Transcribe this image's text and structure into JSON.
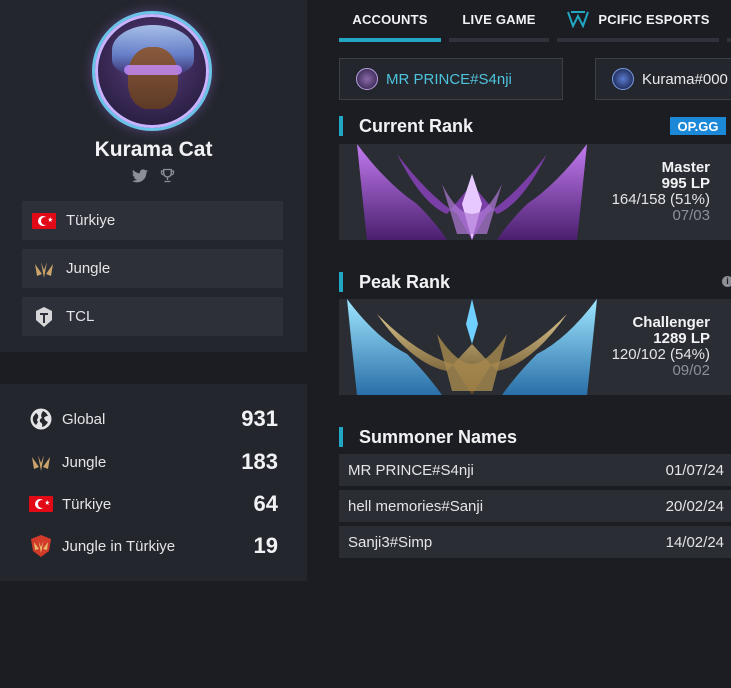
{
  "profile": {
    "name": "Kurama Cat",
    "social": [
      "twitter-icon",
      "trophy-icon"
    ],
    "info": [
      {
        "icon": "turkey-flag-icon",
        "label": "Türkiye"
      },
      {
        "icon": "jungle-role-icon",
        "label": "Jungle"
      },
      {
        "icon": "tcl-league-icon",
        "label": "TCL"
      }
    ]
  },
  "stats": [
    {
      "icon": "globe-icon",
      "label": "Global",
      "value": "931"
    },
    {
      "icon": "jungle-role-icon",
      "label": "Jungle",
      "value": "183"
    },
    {
      "icon": "turkey-flag-icon",
      "label": "Türkiye",
      "value": "64"
    },
    {
      "icon": "jungle-region-icon",
      "label": "Jungle in Türkiye",
      "value": "19"
    }
  ],
  "tabs": [
    {
      "label": "ACCOUNTS",
      "active": true
    },
    {
      "label": "LIVE GAME",
      "active": false
    },
    {
      "label": "PCIFIC ESPORTS",
      "active": false
    }
  ],
  "accounts": [
    {
      "name": "MR PRINCE#S4nji",
      "color": "#4ec3de"
    },
    {
      "name": "Kurama#000",
      "color": "#e8e8ea"
    }
  ],
  "current_rank": {
    "title": "Current Rank",
    "badge": "OP.GG",
    "tier": "Master",
    "lp": "995 LP",
    "winloss": "164/158 (51%)",
    "date": "07/03"
  },
  "peak_rank": {
    "title": "Peak Rank",
    "tier": "Challenger",
    "lp": "1289 LP",
    "winloss": "120/102 (54%)",
    "date": "09/02"
  },
  "summoner_names": {
    "title": "Summoner Names",
    "rows": [
      {
        "name": "MR PRINCE#S4nji",
        "date": "01/07/24"
      },
      {
        "name": "hell memories#Sanji",
        "date": "20/02/24"
      },
      {
        "name": "Sanji3#Simp",
        "date": "14/02/24"
      }
    ]
  },
  "colors": {
    "accent": "#21a6c3",
    "opgg": "#1b88d8",
    "background": "#1b1d22",
    "card": "#23262d"
  }
}
